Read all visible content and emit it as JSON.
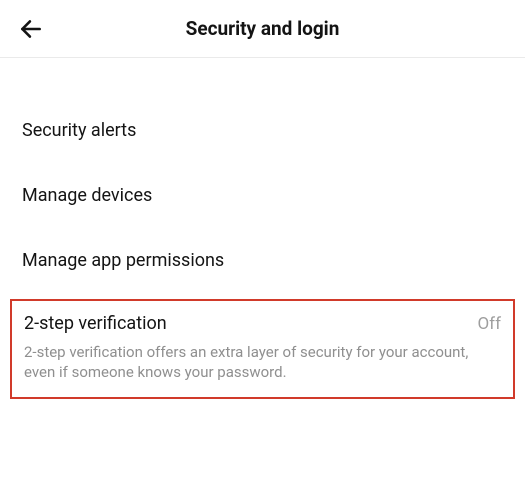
{
  "header": {
    "title": "Security and login"
  },
  "rows": {
    "security_alerts": {
      "label": "Security alerts"
    },
    "manage_devices": {
      "label": "Manage devices"
    },
    "manage_app_permissions": {
      "label": "Manage app permissions"
    }
  },
  "two_step": {
    "label": "2-step verification",
    "status": "Off",
    "description": "2-step verification offers an extra layer of security for your account, even if someone knows your password."
  }
}
